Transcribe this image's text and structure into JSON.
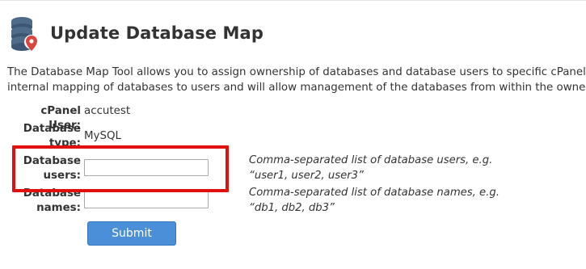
{
  "page": {
    "title": "Update Database Map",
    "description_lines": [
      "The Database Map Tool allows you to assign ownership of databases and database users to specific cPanel acc",
      "internal mapping of databases to users and will allow management of the databases from within the owner’s c"
    ]
  },
  "form": {
    "cpanel_user": {
      "label": "cPanel User:",
      "value": "accutest"
    },
    "database_type": {
      "label_line1": "Database",
      "label_line2": "type:",
      "value": "MySQL"
    },
    "database_users": {
      "label_line1": "Database",
      "label_line2": "users:",
      "value": "",
      "help_line1": "Comma-separated list of database users, e.g.",
      "help_line2": "“user1, user2, user3”"
    },
    "database_names": {
      "label_line1": "Database",
      "label_line2": "names:",
      "value": "",
      "help_line1": "Comma-separated list of database names, e.g.",
      "help_line2": "“db1, db2, db3”"
    },
    "submit_label": "Submit"
  },
  "colors": {
    "accent_button": "#4a8fd8",
    "highlight_box": "#e01010",
    "icon_db": "#4f6b8a",
    "icon_pin": "#d9463e"
  },
  "icons": {
    "header_icon": "database-map-icon"
  }
}
